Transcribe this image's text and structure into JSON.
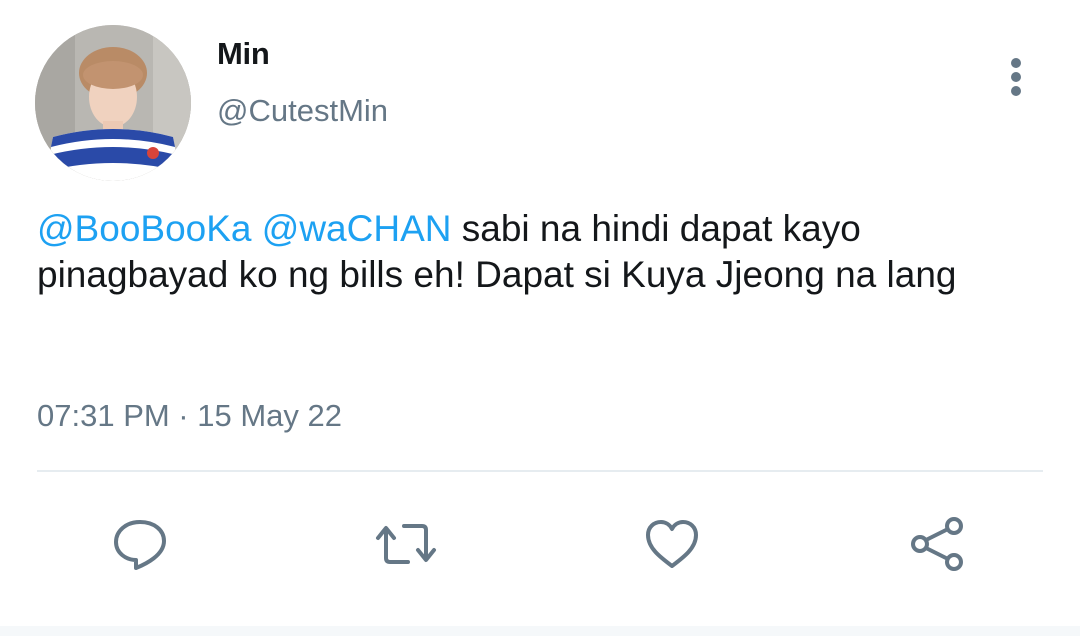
{
  "author": {
    "name": "Min",
    "handle": "@CutestMin",
    "avatar_icon": "profile-photo"
  },
  "tweet": {
    "mention_1": "@BooBooKa",
    "mention_2": "@waCHAN",
    "text_rest": "sabi na hindi dapat kayo pinagbayad ko ng bills eh! Dapat si Kuya Jjeong na lang",
    "timestamp": "07:31 PM · 15 May 22"
  },
  "colors": {
    "mention": "#1da1f2",
    "text": "#14171a",
    "muted": "#657786",
    "divider": "#e6ecf0"
  },
  "actions": {
    "reply_icon": "comment-icon",
    "retweet_icon": "retweet-icon",
    "like_icon": "heart-icon",
    "share_icon": "share-icon"
  }
}
